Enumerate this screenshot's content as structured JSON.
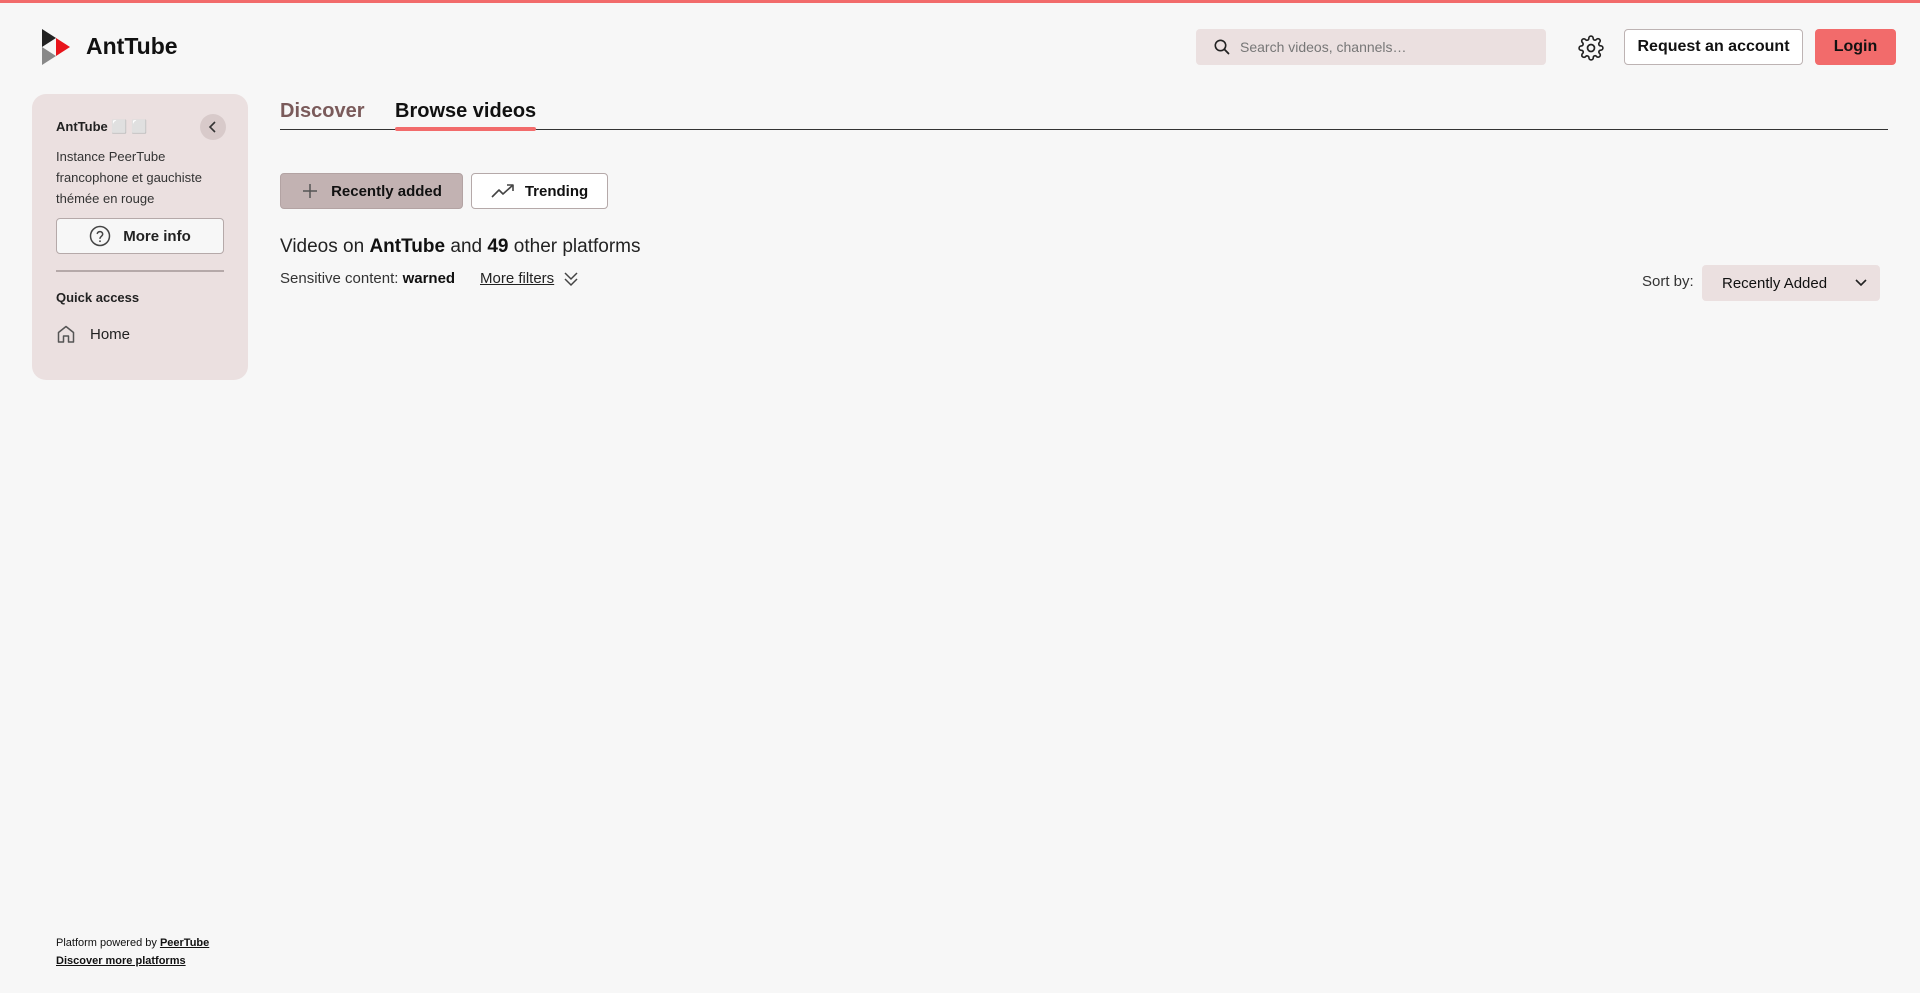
{
  "header": {
    "brand": "AntTube",
    "search_placeholder": "Search videos, channels…",
    "request_account_label": "Request an account",
    "login_label": "Login"
  },
  "sidebar": {
    "instance_title": "AntTube ⬜ ⬜",
    "description": "Instance PeerTube francophone et gauchiste thémée en rouge",
    "more_info_label": "More info",
    "quick_access_label": "Quick access",
    "home_label": "Home"
  },
  "footer": {
    "powered_prefix": "Platform powered by ",
    "peertube_link": "PeerTube",
    "discover_more_link": "Discover more platforms"
  },
  "tabs": [
    {
      "label": "Discover",
      "active": false
    },
    {
      "label": "Browse videos",
      "active": true
    }
  ],
  "filters": {
    "recently_added_label": "Recently added",
    "trending_label": "Trending",
    "videos_on_prefix": "Videos on ",
    "videos_on_instance": "AntTube",
    "videos_on_and": " and ",
    "platform_count": "49",
    "videos_on_suffix": " other platforms",
    "sensitive_label": "Sensitive content: ",
    "sensitive_value": "warned",
    "more_filters_label": "More filters",
    "sort_by_label": "Sort by:",
    "sort_value": "Recently Added"
  },
  "colors": {
    "accent": "#f26b6b",
    "sidebar_bg": "#ebe0e0",
    "active_filter_bg": "#c2b2b2",
    "page_bg": "#f7f7f7"
  },
  "icons": {
    "logo": "peertube-play-logo",
    "search": "search-icon",
    "settings": "gear-icon",
    "collapse": "chevron-left-icon",
    "info": "question-circle-icon",
    "home": "home-icon",
    "add": "plus-icon",
    "trending": "trending-up-icon",
    "more_filters": "double-chevron-down-icon",
    "sort_dropdown": "chevron-down-icon"
  }
}
